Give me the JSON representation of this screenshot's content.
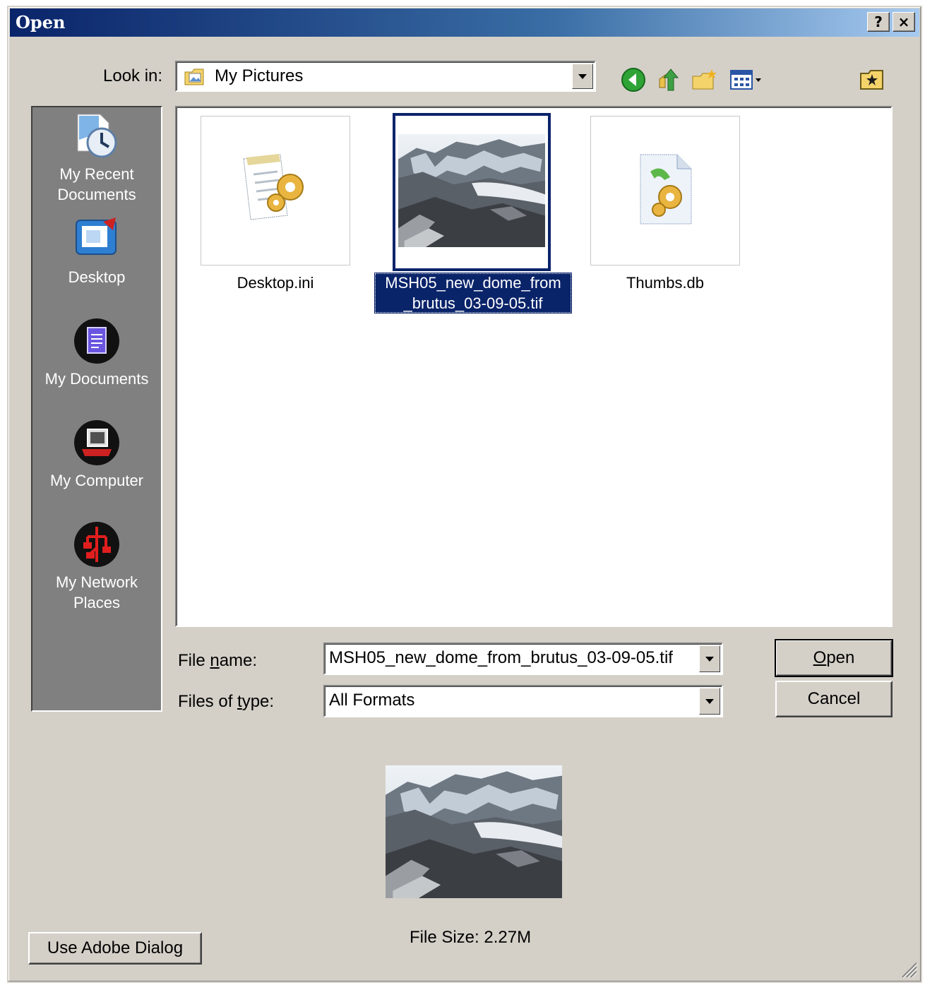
{
  "window": {
    "title": "Open",
    "help_label": "?",
    "close_label": "×"
  },
  "look_in": {
    "label": "Look in:",
    "value": "My Pictures"
  },
  "places": [
    {
      "line1": "My Recent",
      "line2": "Documents"
    },
    {
      "line1": "Desktop",
      "line2": ""
    },
    {
      "line1": "My Documents",
      "line2": ""
    },
    {
      "line1": "My Computer",
      "line2": ""
    },
    {
      "line1": "My Network",
      "line2": "Places"
    }
  ],
  "files": [
    {
      "line1": "Desktop.ini",
      "line2": ""
    },
    {
      "line1": "MSH05_new_dome_from",
      "line2": "_brutus_03-09-05.tif"
    },
    {
      "line1": "Thumbs.db",
      "line2": ""
    }
  ],
  "file_name": {
    "label_pre": "File ",
    "label_key": "n",
    "label_post": "ame:",
    "value": "MSH05_new_dome_from_brutus_03-09-05.tif"
  },
  "file_type": {
    "label_pre": "Files of ",
    "label_key": "t",
    "label_post": "ype:",
    "value": "All Formats"
  },
  "buttons": {
    "open_key": "O",
    "open_rest": "pen",
    "cancel": "Cancel",
    "adobe": "Use Adobe Dialog"
  },
  "preview": {
    "file_size": "File Size: 2.27M"
  }
}
